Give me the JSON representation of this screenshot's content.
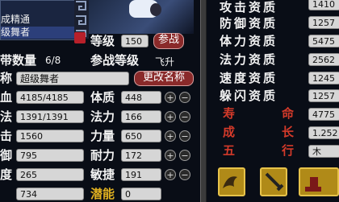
{
  "list": {
    "items": [
      "",
      "成精通",
      "级舞者"
    ]
  },
  "level": {
    "label": "等级",
    "value": "150",
    "release_label": "参战"
  },
  "carry": {
    "label": "带数量",
    "value": "6/8",
    "join_label": "参战等级",
    "join_value": "飞升"
  },
  "name": {
    "label": "称",
    "value": "超级舞者",
    "rename_label": "更改名称"
  },
  "left_stats": [
    {
      "label": "血",
      "value": "4185/4185"
    },
    {
      "label": "法",
      "value": "1391/1391"
    },
    {
      "label": "击",
      "value": "1560"
    },
    {
      "label": "御",
      "value": "795"
    },
    {
      "label": "度",
      "value": "265"
    },
    {
      "label": "",
      "value": "734"
    }
  ],
  "attrs": [
    {
      "label": "体质",
      "value": "448"
    },
    {
      "label": "法力",
      "value": "166"
    },
    {
      "label": "力量",
      "value": "650"
    },
    {
      "label": "耐力",
      "value": "172"
    },
    {
      "label": "敏捷",
      "value": "191"
    },
    {
      "label": "潜能",
      "value": "0"
    }
  ],
  "aptitudes": [
    {
      "label": "攻击资质",
      "value": "1410"
    },
    {
      "label": "防御资质",
      "value": "1257"
    },
    {
      "label": "体力资质",
      "value": "5475"
    },
    {
      "label": "法力资质",
      "value": "2562"
    },
    {
      "label": "速度资质",
      "value": "1245"
    },
    {
      "label": "躲闪资质",
      "value": "1257"
    }
  ],
  "extra": [
    {
      "label": "寿命",
      "value": "4775"
    },
    {
      "label": "成长",
      "value": "1.252"
    },
    {
      "label": "五行",
      "value": "木"
    }
  ],
  "colors": {
    "aptitude_label": "#f2f2f2",
    "extra_label": "#d43a2a",
    "accent": "#8a2a2a"
  },
  "icons": {
    "skill_icons": [
      "bird-skill-icon",
      "sword-skill-icon",
      "shoes-skill-icon"
    ]
  }
}
